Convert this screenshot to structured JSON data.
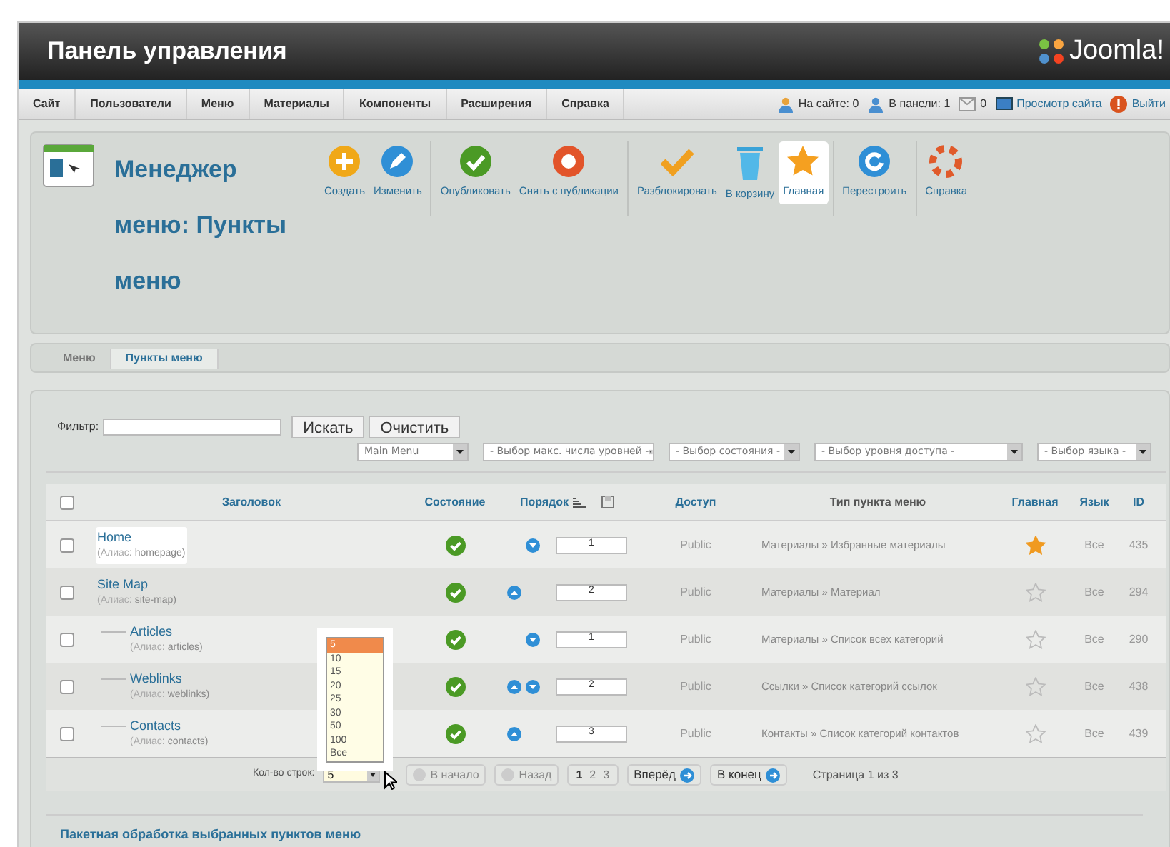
{
  "header": {
    "title": "Панель управления",
    "logo": "Joomla!"
  },
  "menu_bar": {
    "items": [
      "Сайт",
      "Пользователи",
      "Меню",
      "Материалы",
      "Компоненты",
      "Расширения",
      "Справка"
    ],
    "status": [
      {
        "kind": "users",
        "label": "На сайте: 0"
      },
      {
        "kind": "admins",
        "label": "В панели: 1"
      },
      {
        "kind": "mail",
        "label": "0"
      },
      {
        "kind": "view",
        "label": "Просмотр сайта"
      },
      {
        "kind": "logout",
        "label": "Выйти"
      }
    ]
  },
  "toolbar": {
    "title": "Менеджер меню: Пункты меню",
    "groups": [
      {
        "buttons": [
          {
            "kind": "new",
            "label": "Создать",
            "selected": false
          },
          {
            "kind": "edit",
            "label": "Изменить",
            "selected": false
          }
        ]
      },
      {
        "buttons": [
          {
            "kind": "publish",
            "label": "Опубликовать",
            "selected": false
          },
          {
            "kind": "unpublish",
            "label": "Снять с публикации",
            "selected": false
          }
        ]
      },
      {
        "buttons": [
          {
            "kind": "checkin",
            "label": "Разблокировать",
            "selected": false
          },
          {
            "kind": "trash",
            "label": "В корзину",
            "selected": false
          },
          {
            "kind": "default",
            "label": "Главная",
            "selected": true
          }
        ]
      },
      {
        "buttons": [
          {
            "kind": "rebuild",
            "label": "Перестроить",
            "selected": false
          }
        ]
      },
      {
        "buttons": [
          {
            "kind": "help",
            "label": "Справка",
            "selected": false
          }
        ]
      }
    ]
  },
  "submenu": [
    {
      "label": "Меню",
      "selected": false
    },
    {
      "label": "Пункты меню",
      "selected": true
    }
  ],
  "filter": {
    "label": "Фильтр:",
    "search_button": "Искать",
    "clear_button": "Очистить",
    "selects": [
      "Main Menu",
      "- Выбор макс. числа уровней -",
      "- Выбор состояния -",
      "- Выбор уровня доступа -",
      "- Выбор языка -"
    ]
  },
  "table": {
    "select_all_checked": false,
    "columns": [
      "Заголовок",
      "Состояние",
      "Порядок",
      "Доступ",
      "Тип пункта меню",
      "Главная",
      "Язык",
      "ID"
    ],
    "rows": [
      {
        "title": "Home",
        "alias_label": "(Алиас:",
        "alias": "homepage)",
        "highlighted": true,
        "checked": false,
        "published": true,
        "order_up": false,
        "order_down": true,
        "order": "1",
        "access": "Public",
        "type": "Материалы » Избранные материалы",
        "home": true,
        "language": "Все",
        "id": "435"
      },
      {
        "title": "Site Map",
        "alias_label": "(Алиас:",
        "alias": "site-map)",
        "highlighted": false,
        "checked": false,
        "published": true,
        "order_up": true,
        "order_down": false,
        "order": "2",
        "access": "Public",
        "type": "Материалы » Материал",
        "home": false,
        "language": "Все",
        "id": "294",
        "children": [
          {
            "title": "Articles",
            "alias_label": "(Алиас:",
            "alias": "articles)",
            "highlighted": false,
            "checked": false,
            "published": true,
            "order_up": false,
            "order_down": true,
            "order": "1",
            "access": "Public",
            "type": "Материалы » Список всех категорий",
            "home": false,
            "language": "Все",
            "id": "290"
          },
          {
            "title": "Weblinks",
            "alias_label": "(Алиас:",
            "alias": "weblinks)",
            "highlighted": false,
            "checked": false,
            "published": true,
            "order_up": true,
            "order_down": true,
            "order": "2",
            "access": "Public",
            "type": "Ссылки » Список категорий ссылок",
            "home": false,
            "language": "Все",
            "id": "438"
          },
          {
            "title": "Contacts",
            "alias_label": "(Алиас:",
            "alias": "contacts)",
            "highlighted": false,
            "checked": false,
            "published": true,
            "order_up": true,
            "order_down": false,
            "order": "3",
            "access": "Public",
            "type": "Контакты » Список категорий контактов",
            "home": false,
            "language": "Все",
            "id": "439"
          }
        ]
      }
    ]
  },
  "pagination": {
    "rows_label": "Кол-во строк:",
    "rows_value": "5",
    "rows_options": [
      {
        "label": "5",
        "selected": true
      },
      {
        "label": "10",
        "selected": false
      },
      {
        "label": "15",
        "selected": false
      },
      {
        "label": "20",
        "selected": false
      },
      {
        "label": "25",
        "selected": false
      },
      {
        "label": "30",
        "selected": false
      },
      {
        "label": "50",
        "selected": false
      },
      {
        "label": "100",
        "selected": false
      },
      {
        "label": "Все",
        "selected": false
      }
    ],
    "start": "В начало",
    "prev": "Назад",
    "pages": [
      {
        "label": "1",
        "selected": true
      },
      {
        "label": "2",
        "selected": false
      },
      {
        "label": "3",
        "selected": false
      }
    ],
    "next": "Вперёд",
    "end": "В конец",
    "info": "Страница 1 из 3"
  },
  "batch": {
    "title": "Пакетная обработка выбранных пунктов меню"
  }
}
